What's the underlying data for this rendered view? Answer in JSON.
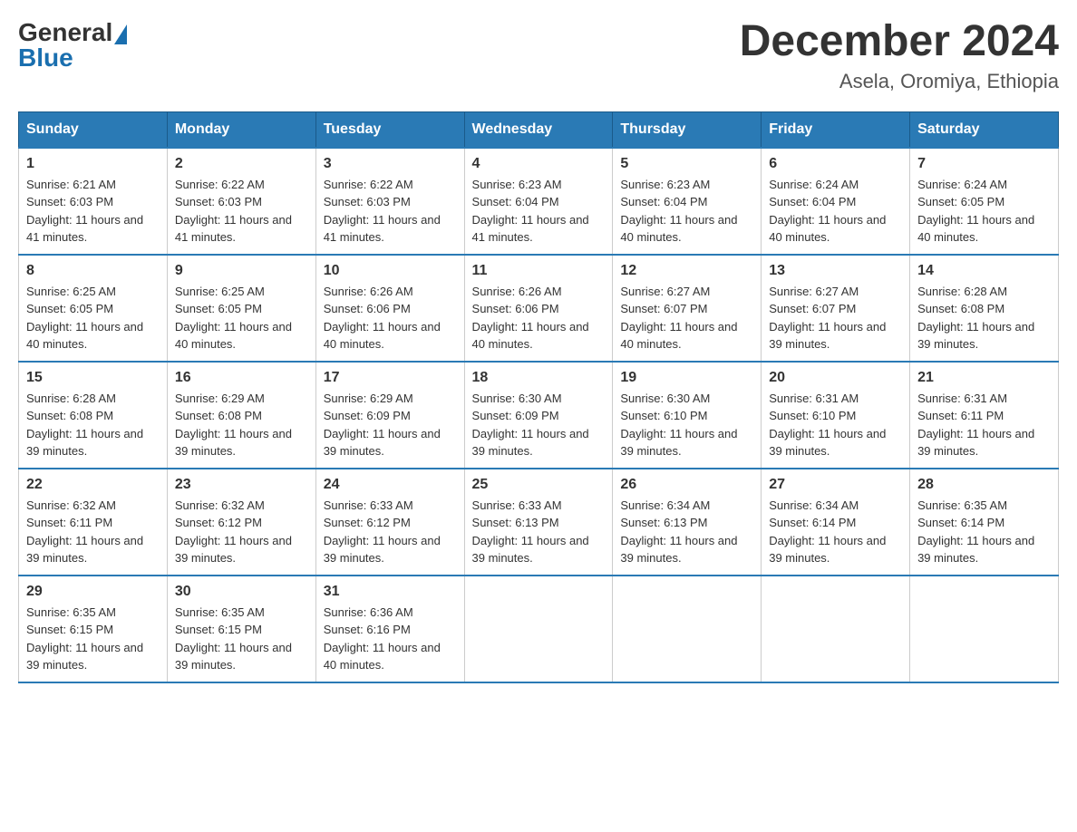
{
  "header": {
    "month_year": "December 2024",
    "location": "Asela, Oromiya, Ethiopia",
    "logo_general": "General",
    "logo_blue": "Blue"
  },
  "days_of_week": [
    "Sunday",
    "Monday",
    "Tuesday",
    "Wednesday",
    "Thursday",
    "Friday",
    "Saturday"
  ],
  "weeks": [
    [
      {
        "day": "1",
        "sunrise": "6:21 AM",
        "sunset": "6:03 PM",
        "daylight": "11 hours and 41 minutes."
      },
      {
        "day": "2",
        "sunrise": "6:22 AM",
        "sunset": "6:03 PM",
        "daylight": "11 hours and 41 minutes."
      },
      {
        "day": "3",
        "sunrise": "6:22 AM",
        "sunset": "6:03 PM",
        "daylight": "11 hours and 41 minutes."
      },
      {
        "day": "4",
        "sunrise": "6:23 AM",
        "sunset": "6:04 PM",
        "daylight": "11 hours and 41 minutes."
      },
      {
        "day": "5",
        "sunrise": "6:23 AM",
        "sunset": "6:04 PM",
        "daylight": "11 hours and 40 minutes."
      },
      {
        "day": "6",
        "sunrise": "6:24 AM",
        "sunset": "6:04 PM",
        "daylight": "11 hours and 40 minutes."
      },
      {
        "day": "7",
        "sunrise": "6:24 AM",
        "sunset": "6:05 PM",
        "daylight": "11 hours and 40 minutes."
      }
    ],
    [
      {
        "day": "8",
        "sunrise": "6:25 AM",
        "sunset": "6:05 PM",
        "daylight": "11 hours and 40 minutes."
      },
      {
        "day": "9",
        "sunrise": "6:25 AM",
        "sunset": "6:05 PM",
        "daylight": "11 hours and 40 minutes."
      },
      {
        "day": "10",
        "sunrise": "6:26 AM",
        "sunset": "6:06 PM",
        "daylight": "11 hours and 40 minutes."
      },
      {
        "day": "11",
        "sunrise": "6:26 AM",
        "sunset": "6:06 PM",
        "daylight": "11 hours and 40 minutes."
      },
      {
        "day": "12",
        "sunrise": "6:27 AM",
        "sunset": "6:07 PM",
        "daylight": "11 hours and 40 minutes."
      },
      {
        "day": "13",
        "sunrise": "6:27 AM",
        "sunset": "6:07 PM",
        "daylight": "11 hours and 39 minutes."
      },
      {
        "day": "14",
        "sunrise": "6:28 AM",
        "sunset": "6:08 PM",
        "daylight": "11 hours and 39 minutes."
      }
    ],
    [
      {
        "day": "15",
        "sunrise": "6:28 AM",
        "sunset": "6:08 PM",
        "daylight": "11 hours and 39 minutes."
      },
      {
        "day": "16",
        "sunrise": "6:29 AM",
        "sunset": "6:08 PM",
        "daylight": "11 hours and 39 minutes."
      },
      {
        "day": "17",
        "sunrise": "6:29 AM",
        "sunset": "6:09 PM",
        "daylight": "11 hours and 39 minutes."
      },
      {
        "day": "18",
        "sunrise": "6:30 AM",
        "sunset": "6:09 PM",
        "daylight": "11 hours and 39 minutes."
      },
      {
        "day": "19",
        "sunrise": "6:30 AM",
        "sunset": "6:10 PM",
        "daylight": "11 hours and 39 minutes."
      },
      {
        "day": "20",
        "sunrise": "6:31 AM",
        "sunset": "6:10 PM",
        "daylight": "11 hours and 39 minutes."
      },
      {
        "day": "21",
        "sunrise": "6:31 AM",
        "sunset": "6:11 PM",
        "daylight": "11 hours and 39 minutes."
      }
    ],
    [
      {
        "day": "22",
        "sunrise": "6:32 AM",
        "sunset": "6:11 PM",
        "daylight": "11 hours and 39 minutes."
      },
      {
        "day": "23",
        "sunrise": "6:32 AM",
        "sunset": "6:12 PM",
        "daylight": "11 hours and 39 minutes."
      },
      {
        "day": "24",
        "sunrise": "6:33 AM",
        "sunset": "6:12 PM",
        "daylight": "11 hours and 39 minutes."
      },
      {
        "day": "25",
        "sunrise": "6:33 AM",
        "sunset": "6:13 PM",
        "daylight": "11 hours and 39 minutes."
      },
      {
        "day": "26",
        "sunrise": "6:34 AM",
        "sunset": "6:13 PM",
        "daylight": "11 hours and 39 minutes."
      },
      {
        "day": "27",
        "sunrise": "6:34 AM",
        "sunset": "6:14 PM",
        "daylight": "11 hours and 39 minutes."
      },
      {
        "day": "28",
        "sunrise": "6:35 AM",
        "sunset": "6:14 PM",
        "daylight": "11 hours and 39 minutes."
      }
    ],
    [
      {
        "day": "29",
        "sunrise": "6:35 AM",
        "sunset": "6:15 PM",
        "daylight": "11 hours and 39 minutes."
      },
      {
        "day": "30",
        "sunrise": "6:35 AM",
        "sunset": "6:15 PM",
        "daylight": "11 hours and 39 minutes."
      },
      {
        "day": "31",
        "sunrise": "6:36 AM",
        "sunset": "6:16 PM",
        "daylight": "11 hours and 40 minutes."
      },
      null,
      null,
      null,
      null
    ]
  ],
  "labels": {
    "sunrise_prefix": "Sunrise: ",
    "sunset_prefix": "Sunset: ",
    "daylight_prefix": "Daylight: "
  }
}
